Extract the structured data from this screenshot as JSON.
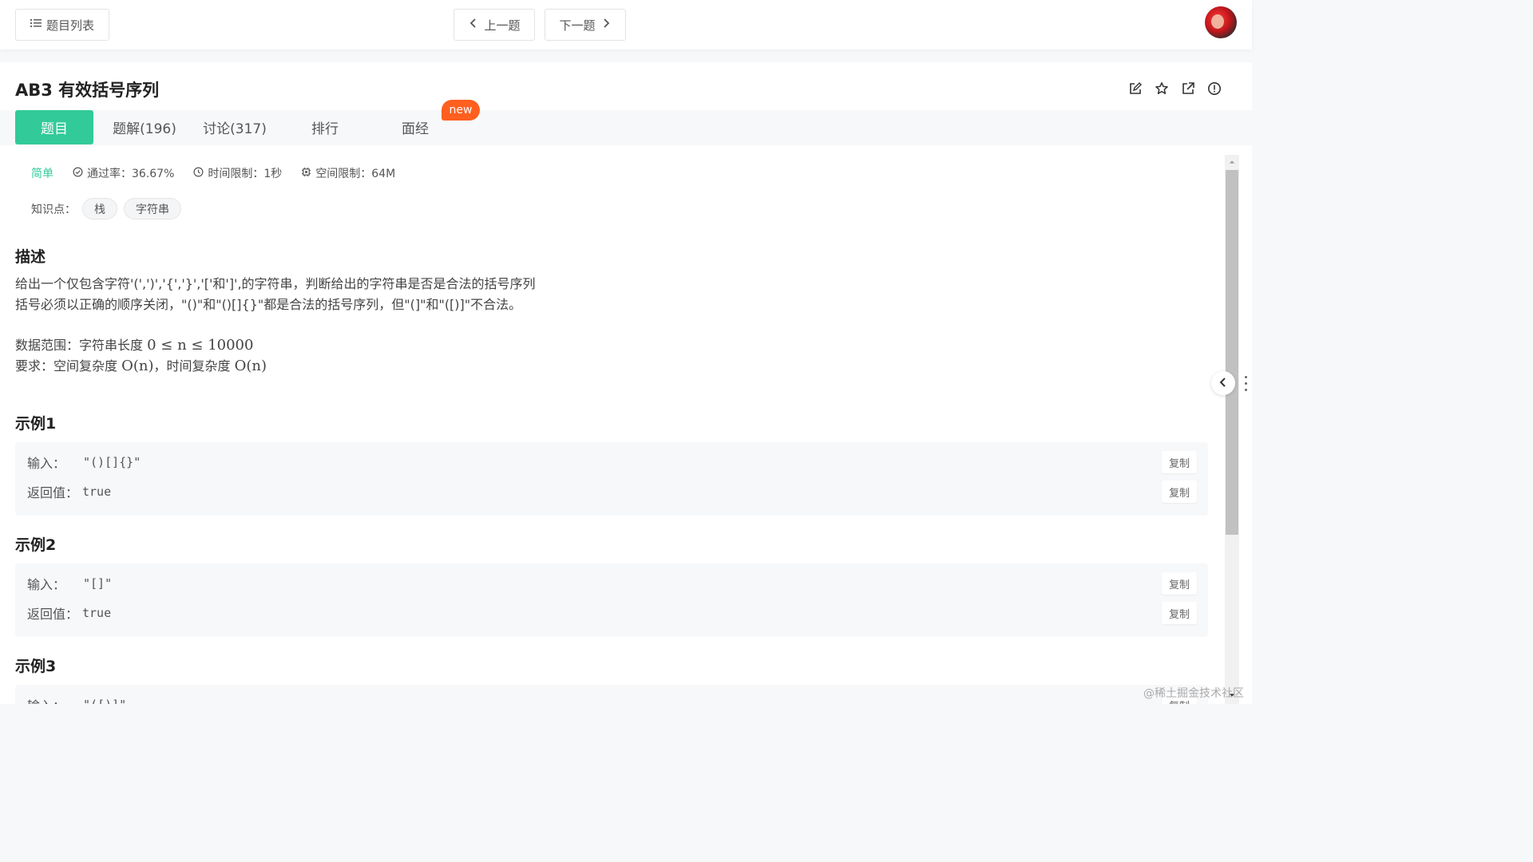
{
  "topbar": {
    "list_label": "题目列表",
    "prev_label": "上一题",
    "next_label": "下一题"
  },
  "problem": {
    "title": "AB3  有效括号序列",
    "tabs": [
      {
        "label": "题目"
      },
      {
        "label": "题解(196)"
      },
      {
        "label": "讨论(317)"
      },
      {
        "label": "排行"
      },
      {
        "label": "面经"
      }
    ],
    "new_badge": "new",
    "difficulty": "简单",
    "pass_rate": "通过率：36.67%",
    "time_limit": "时间限制：1秒",
    "space_limit": "空间限制：64M",
    "knowledge_label": "知识点：",
    "tags": [
      "栈",
      "字符串"
    ]
  },
  "description": {
    "heading": "描述",
    "line1": "给出一个仅包含字符'(',')','{','}','['和']',的字符串，判断给出的字符串是否是合法的括号序列",
    "line2": "括号必须以正确的顺序关闭，\"()\"和\"()[]{}\"都是合法的括号序列，但\"(]\"和\"([)]\"不合法。",
    "range_prefix": "数据范围：字符串长度 ",
    "range_math": "0 ≤ n ≤ 10000",
    "req_prefix": "要求：空间复杂度 ",
    "req_space": "O(n)",
    "req_mid": "，时间复杂度 ",
    "req_time": "O(n)"
  },
  "examples": [
    {
      "heading": "示例1",
      "input_label": "输入：",
      "input": "\"()[]{}\"",
      "output_label": "返回值：",
      "output": "true",
      "copy": "复制"
    },
    {
      "heading": "示例2",
      "input_label": "输入：",
      "input": "\"[]\"",
      "output_label": "返回值：",
      "output": "true",
      "copy": "复制"
    },
    {
      "heading": "示例3",
      "input_label": "输入：",
      "input": "\"([)]\"",
      "copy": "复制"
    }
  ],
  "watermark": "@稀土掘金技术社区",
  "colors": {
    "accent": "#32ca99",
    "new_badge": "#ff5f1f"
  }
}
